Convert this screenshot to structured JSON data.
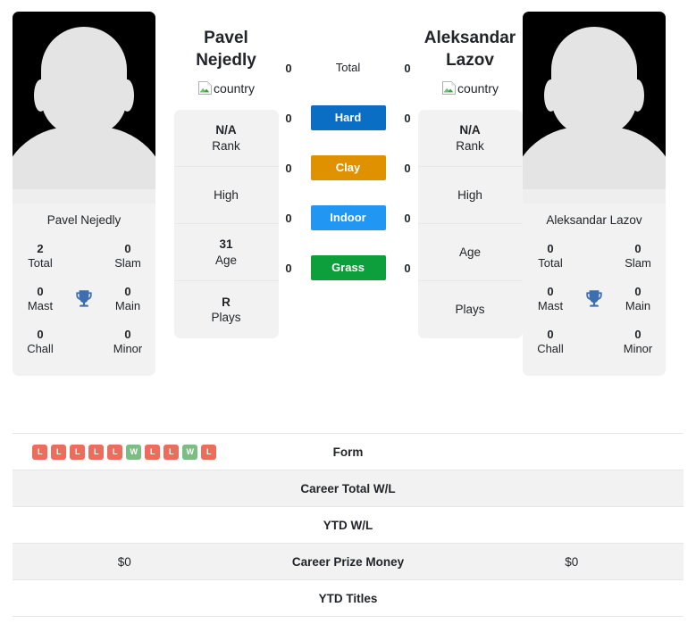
{
  "players": {
    "left": {
      "name": "Pavel Nejedly",
      "name_line1": "Pavel",
      "name_line2": "Nejedly",
      "country_alt": "country",
      "card_name": "Pavel Nejedly",
      "titles": [
        {
          "value": "2",
          "label": "Total"
        },
        {
          "value": "0",
          "label": "Slam"
        },
        {
          "value": "0",
          "label": "Mast"
        },
        {
          "value": "0",
          "label": "Main"
        },
        {
          "value": "0",
          "label": "Chall"
        },
        {
          "value": "0",
          "label": "Minor"
        }
      ],
      "info": [
        {
          "value": "N/A",
          "label": "Rank"
        },
        {
          "value": "",
          "label": "High"
        },
        {
          "value": "31",
          "label": "Age"
        },
        {
          "value": "R",
          "label": "Plays"
        }
      ],
      "surface_wins": [
        "0",
        "0",
        "0",
        "0",
        "0"
      ],
      "form": [
        "L",
        "L",
        "L",
        "L",
        "L",
        "W",
        "L",
        "L",
        "W",
        "L"
      ],
      "career_total_wl": "",
      "ytd_wl": "",
      "career_prize_money": "$0",
      "ytd_titles": ""
    },
    "right": {
      "name": "Aleksandar Lazov",
      "name_line1": "Aleksandar",
      "name_line2": "Lazov",
      "country_alt": "country",
      "card_name": "Aleksandar Lazov",
      "titles": [
        {
          "value": "0",
          "label": "Total"
        },
        {
          "value": "0",
          "label": "Slam"
        },
        {
          "value": "0",
          "label": "Mast"
        },
        {
          "value": "0",
          "label": "Main"
        },
        {
          "value": "0",
          "label": "Chall"
        },
        {
          "value": "0",
          "label": "Minor"
        }
      ],
      "info": [
        {
          "value": "N/A",
          "label": "Rank"
        },
        {
          "value": "",
          "label": "High"
        },
        {
          "value": "",
          "label": "Age"
        },
        {
          "value": "",
          "label": "Plays"
        }
      ],
      "surface_wins": [
        "0",
        "0",
        "0",
        "0",
        "0"
      ],
      "form": [],
      "career_total_wl": "",
      "ytd_wl": "",
      "career_prize_money": "$0",
      "ytd_titles": ""
    }
  },
  "surfaces": [
    {
      "label": "Total",
      "color": "transparent",
      "plain": true
    },
    {
      "label": "Hard",
      "color": "#0a6ec4",
      "plain": false
    },
    {
      "label": "Clay",
      "color": "#e09100",
      "plain": false
    },
    {
      "label": "Indoor",
      "color": "#2196f3",
      "plain": false
    },
    {
      "label": "Grass",
      "color": "#0e9f3d",
      "plain": false
    }
  ],
  "table_rows": [
    {
      "label": "Form"
    },
    {
      "label": "Career Total W/L"
    },
    {
      "label": "YTD W/L"
    },
    {
      "label": "Career Prize Money"
    },
    {
      "label": "YTD Titles"
    }
  ],
  "colors": {
    "win_badge": "#ec6d5c",
    "loss_badge": "#7bbd83",
    "trophy": "#3d6fb0",
    "card_bg": "#f2f2f2",
    "stripe": "#f2f2f2",
    "border": "#e6e6e6"
  },
  "icons": {
    "trophy": "trophy-icon",
    "broken_image": "broken-image-icon"
  }
}
